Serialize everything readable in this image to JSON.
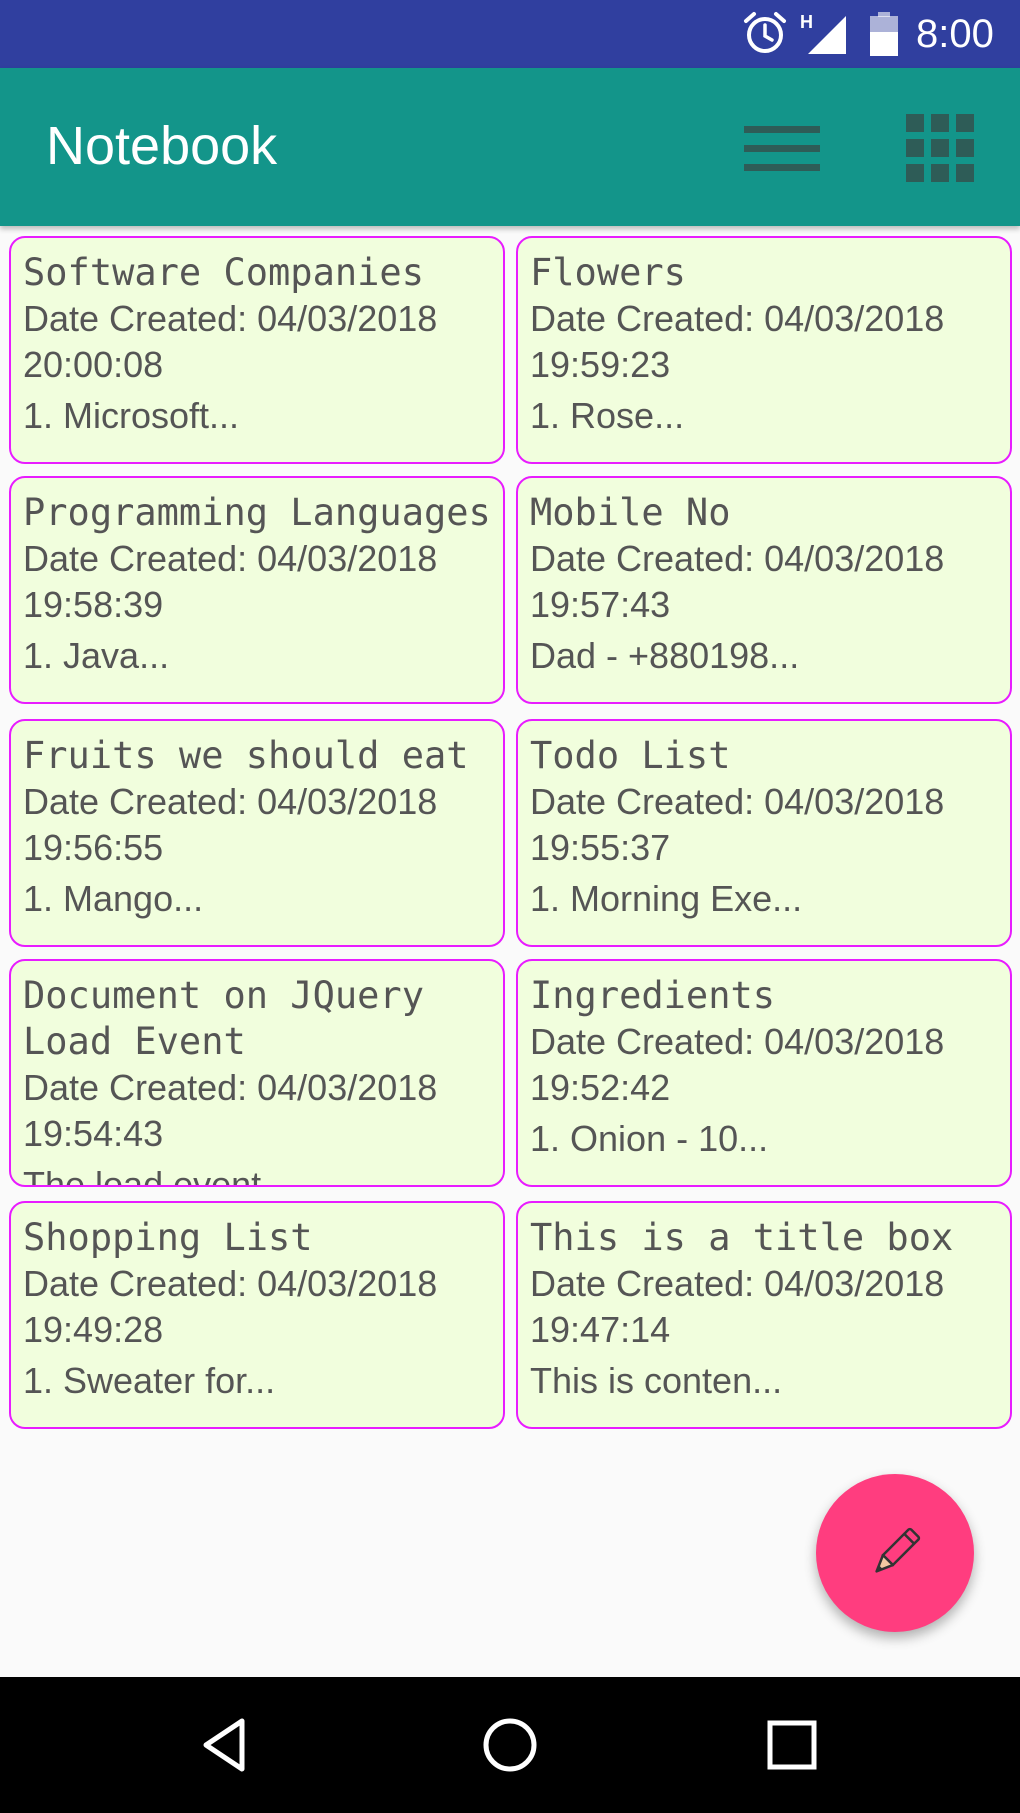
{
  "status_bar": {
    "network_label": "H",
    "time": "8:00",
    "icons": [
      "alarm-icon",
      "signal-icon",
      "battery-icon"
    ]
  },
  "app_bar": {
    "title": "Notebook",
    "icons": [
      "menu-icon",
      "grid-view-icon"
    ]
  },
  "notes": [
    {
      "title": "Software Companies",
      "date": "Date Created: 04/03/2018 20:00:08",
      "preview": "1. Microsoft..."
    },
    {
      "title": "Flowers",
      "date": "Date Created: 04/03/2018 19:59:23",
      "preview": "1. Rose..."
    },
    {
      "title": "Programming Languages",
      "date": "Date Created: 04/03/2018 19:58:39",
      "preview": "1. Java..."
    },
    {
      "title": "Mobile No",
      "date": "Date Created: 04/03/2018 19:57:43",
      "preview": "Dad - +880198..."
    },
    {
      "title": "Fruits we should eat",
      "date": "Date Created: 04/03/2018 19:56:55",
      "preview": "1. Mango..."
    },
    {
      "title": "Todo List",
      "date": "Date Created: 04/03/2018 19:55:37",
      "preview": "1. Morning Exe..."
    },
    {
      "title": "Document on JQuery Load Event",
      "date": "Date Created: 04/03/2018 19:54:43",
      "preview": "The load event..."
    },
    {
      "title": "Ingredients",
      "date": "Date Created: 04/03/2018 19:52:42",
      "preview": "1. Onion  - 10..."
    },
    {
      "title": "Shopping List",
      "date": "Date Created: 04/03/2018 19:49:28",
      "preview": "1. Sweater for..."
    },
    {
      "title": "This is a title box",
      "date": "Date Created: 04/03/2018 19:47:14",
      "preview": "This is conten..."
    }
  ],
  "fab": {
    "icon": "pencil-icon"
  },
  "nav_bar": {
    "icons": [
      "back-icon",
      "home-icon",
      "recents-icon"
    ]
  },
  "colors": {
    "status_bar": "#303f9f",
    "app_bar": "#13958a",
    "card_background": "#f1fedd",
    "card_border": "#e81cff",
    "fab": "#ff3d7f"
  }
}
